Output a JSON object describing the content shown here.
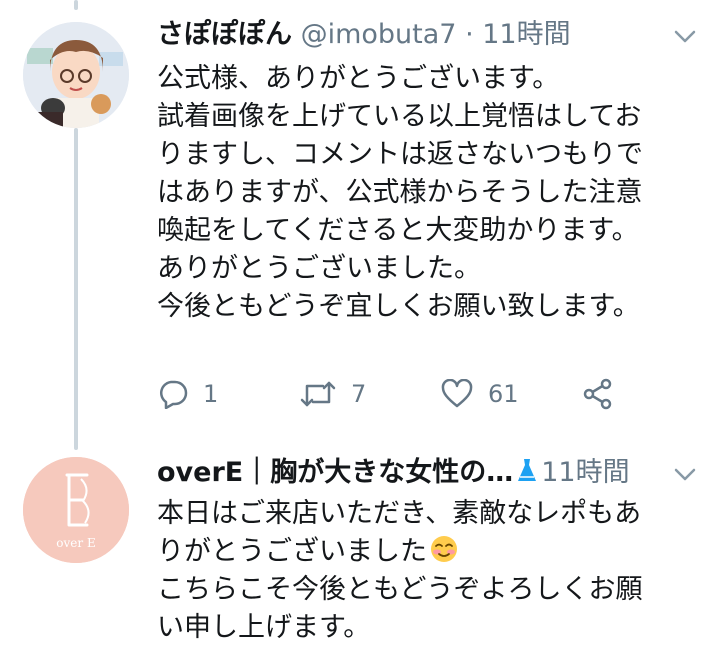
{
  "tweet1": {
    "display_name": "さぽぽぽん",
    "handle": "@imobuta7",
    "time_separator": " · ",
    "time": "11時間",
    "lines": [
      "公式様、ありがとうございます。",
      "試着画像を上げている以上覚悟はしてお",
      "りますし、コメントは返さないつもりで",
      "はありますが、公式様からそうした注意",
      "喚起をしてくださると大変助かります。",
      "ありがとうございました。",
      "今後ともどうぞ宜しくお願い致します。"
    ],
    "actions": {
      "reply_count": "1",
      "retweet_count": "7",
      "like_count": "61"
    }
  },
  "tweet2": {
    "display_name": "overE｜胸が大きな女性の…",
    "time": "11時間",
    "avatar_text": "over E",
    "lines": [
      "本日はご来店いただき、素敵なレポもあ",
      "りがとうございました",
      "こちらこそ今後ともどうぞよろしくお願",
      "い申し上げます。"
    ]
  },
  "colors": {
    "text": "#14171a",
    "secondary": "#657786",
    "thread_line": "#ccd6dd",
    "overE_avatar_bg": "#f6c9bd",
    "dress_icon": "#1da1f2"
  },
  "icons": [
    "reply-icon",
    "retweet-icon",
    "like-icon",
    "share-icon",
    "chevron-down-icon",
    "dress-emoji-icon",
    "smiling-face-emoji-icon"
  ]
}
